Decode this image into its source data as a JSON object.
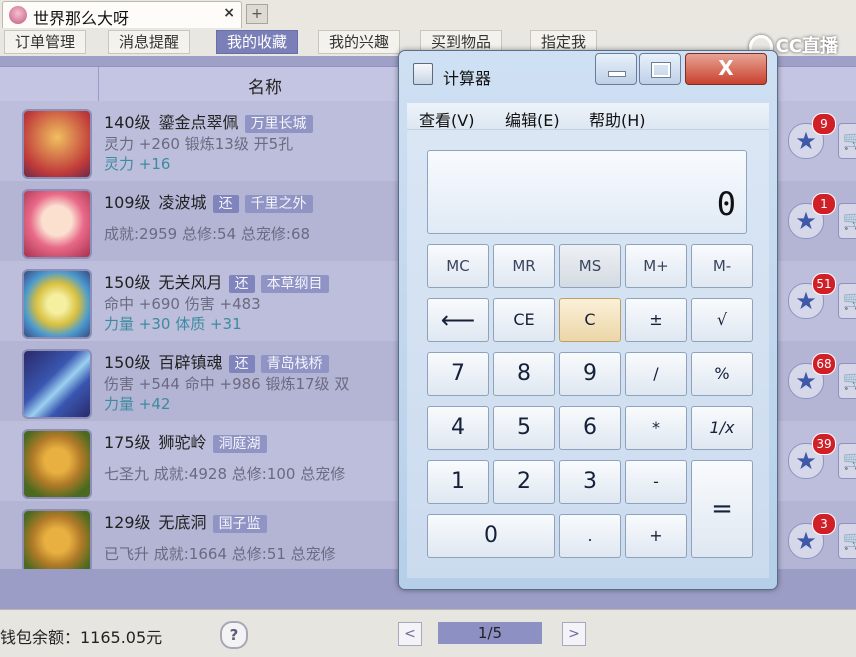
{
  "browser": {
    "tab_title": "世界那么大呀",
    "close_label": "×",
    "new_tab_label": "+"
  },
  "nav": {
    "items": [
      "订单管理",
      "消息提醒",
      "我的收藏",
      "我的兴趣",
      "买到物品",
      "指定我"
    ],
    "active_index": 2
  },
  "logo": {
    "text": "CC直播"
  },
  "table": {
    "header_name": "名称"
  },
  "rows": [
    {
      "level": "140级",
      "name": "鎏金点翠佩",
      "tags": [
        "万里长城"
      ],
      "line2": "灵力 +260 锻炼13级 开5孔",
      "line3": "灵力 +16",
      "fav_count": "9",
      "thumb_color": "#c03a3a"
    },
    {
      "level": "109级",
      "name": "凌波城",
      "tags": [
        "还",
        "千里之外"
      ],
      "line2": "成就:2959 总修:54 总宠修:68",
      "line3": "",
      "fav_count": "1",
      "thumb_color": "#e86a88"
    },
    {
      "level": "150级",
      "name": "无关风月",
      "tags": [
        "还",
        "本草纲目"
      ],
      "line2": "命中 +690 伤害 +483",
      "line3": "力量 +30 体质 +31",
      "fav_count": "51",
      "thumb_color": "#d8c040"
    },
    {
      "level": "150级",
      "name": "百辟镇魂",
      "tags": [
        "还",
        "青岛栈桥"
      ],
      "line2": "伤害 +544 命中 +986 锻炼17级 双",
      "line3": "力量 +42",
      "fav_count": "68",
      "thumb_color": "#3a56b0"
    },
    {
      "level": "175级",
      "name": "狮驼岭",
      "tags": [
        "洞庭湖"
      ],
      "line2": "七圣九 成就:4928 总修:100 总宠修",
      "line3": "",
      "fav_count": "39",
      "thumb_color": "#b07a28"
    },
    {
      "level": "129级",
      "name": "无底洞",
      "tags": [
        "国子监"
      ],
      "line2": "已飞升 成就:1664 总修:51 总宠修",
      "line3": "",
      "fav_count": "3",
      "thumb_color": "#b07a28"
    }
  ],
  "footer": {
    "balance": "钱包余额：1165.05元",
    "help": "?",
    "page": "1/5",
    "prev": "<",
    "next": ">"
  },
  "calculator": {
    "title": "计算器",
    "close_label": "X",
    "menus": [
      "查看(V)",
      "编辑(E)",
      "帮助(H)"
    ],
    "display": "0",
    "keys": {
      "mc": "MC",
      "mr": "MR",
      "ms": "MS",
      "mplus": "M+",
      "mminus": "M-",
      "back": "⟵",
      "ce": "CE",
      "c": "C",
      "pm": "±",
      "sqrt": "√",
      "n7": "7",
      "n8": "8",
      "n9": "9",
      "div": "/",
      "pct": "%",
      "n4": "4",
      "n5": "5",
      "n6": "6",
      "mul": "*",
      "inv": "1/x",
      "n1": "1",
      "n2": "2",
      "n3": "3",
      "sub": "-",
      "eq": "=",
      "n0": "0",
      "dot": ".",
      "add": "+"
    }
  }
}
